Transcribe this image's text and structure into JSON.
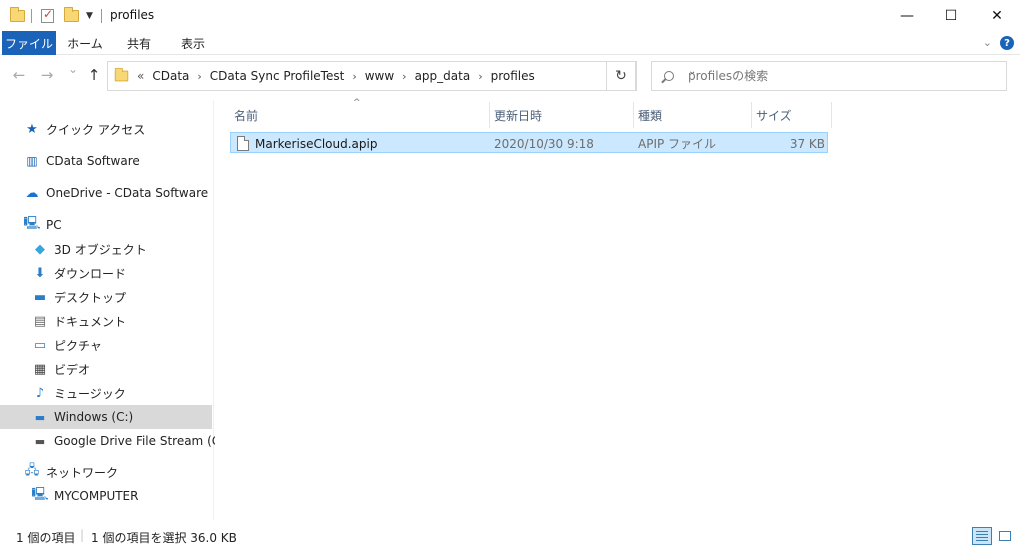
{
  "window": {
    "title": "profiles",
    "minimize_symbol": "—",
    "maximize_symbol": "☐",
    "close_symbol": "✕"
  },
  "ribbon": {
    "tabs": [
      "ファイル",
      "ホーム",
      "共有",
      "表示"
    ],
    "help_symbol": "?"
  },
  "nav": {
    "back_symbol": "←",
    "forward_symbol": "→",
    "recent_symbol": "⌄",
    "up_symbol": "↑",
    "overflow": "«",
    "breadcrumbs": [
      "CData",
      "CData Sync ProfileTest",
      "www",
      "app_data",
      "profiles"
    ],
    "crumb_separator": "›",
    "refresh_symbol": "↻",
    "search_placeholder": "profilesの検索"
  },
  "sidebar": {
    "quick_access": "クイック アクセス",
    "items": [
      {
        "label": "CData Software",
        "icon": "building-icon"
      },
      {
        "label": "OneDrive - CData Software",
        "icon": "cloud-icon"
      },
      {
        "label": "PC",
        "icon": "computer-icon"
      },
      {
        "label": "3D オブジェクト",
        "icon": "cube-icon"
      },
      {
        "label": "ダウンロード",
        "icon": "download-icon"
      },
      {
        "label": "デスクトップ",
        "icon": "desktop-icon"
      },
      {
        "label": "ドキュメント",
        "icon": "document-icon"
      },
      {
        "label": "ピクチャ",
        "icon": "picture-icon"
      },
      {
        "label": "ビデオ",
        "icon": "video-icon"
      },
      {
        "label": "ミュージック",
        "icon": "music-icon"
      },
      {
        "label": "Windows (C:)",
        "icon": "drive-icon"
      },
      {
        "label": "Google Drive File Stream (G:)",
        "icon": "drive-icon"
      },
      {
        "label": "ネットワーク",
        "icon": "network-icon"
      },
      {
        "label": "MYCOMPUTER",
        "icon": "computer-icon"
      }
    ]
  },
  "columns": {
    "name": "名前",
    "modified": "更新日時",
    "type": "種類",
    "size": "サイズ",
    "sort_indicator": "^"
  },
  "files": [
    {
      "name": "MarkeriseCloud.apip",
      "modified": "2020/10/30 9:18",
      "type": "APIP ファイル",
      "size": "37 KB"
    }
  ],
  "status": {
    "item_count": "1 個の項目",
    "selection": "1 個の項目を選択  36.0 KB"
  },
  "colors": {
    "accent": "#1a63b8",
    "selection_bg": "#cce8ff",
    "selection_border": "#99d1ff"
  }
}
